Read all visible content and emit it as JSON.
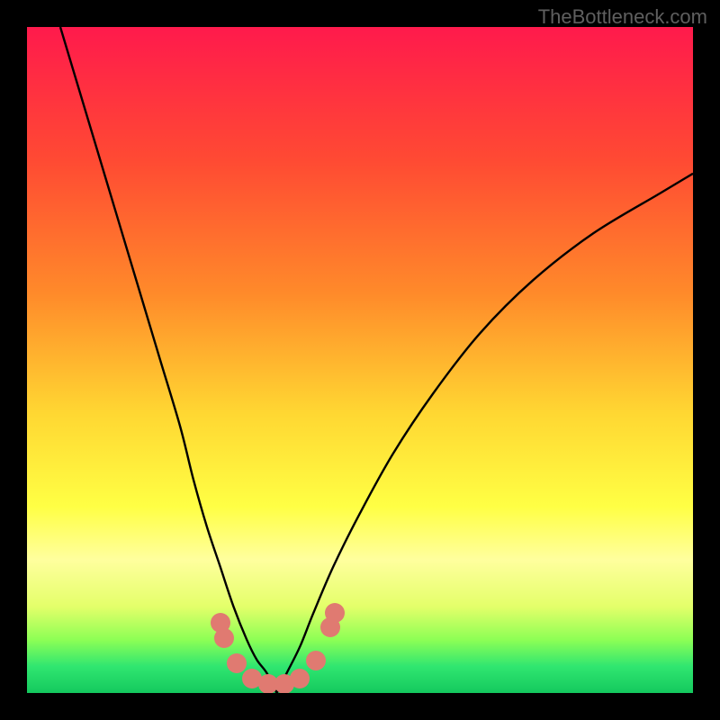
{
  "watermark": "TheBottleneck.com",
  "chart_data": {
    "type": "line",
    "title": "",
    "xlabel": "",
    "ylabel": "",
    "xlim": [
      0,
      100
    ],
    "ylim": [
      0,
      100
    ],
    "gradient_stops": [
      {
        "offset": 0,
        "color": "#ff1a4c"
      },
      {
        "offset": 20,
        "color": "#ff4a33"
      },
      {
        "offset": 40,
        "color": "#ff8a2a"
      },
      {
        "offset": 58,
        "color": "#ffd732"
      },
      {
        "offset": 72,
        "color": "#ffff44"
      },
      {
        "offset": 80,
        "color": "#ffff9e"
      },
      {
        "offset": 87,
        "color": "#e4ff6a"
      },
      {
        "offset": 92,
        "color": "#8dff55"
      },
      {
        "offset": 96,
        "color": "#30e670"
      },
      {
        "offset": 100,
        "color": "#14c95e"
      }
    ],
    "series": [
      {
        "name": "left-branch",
        "x": [
          5,
          8,
          11,
          14,
          17,
          20,
          23,
          25,
          27,
          29,
          31,
          33,
          34.5,
          36,
          37.5
        ],
        "y": [
          100,
          90,
          80,
          70,
          60,
          50,
          40,
          32,
          25,
          19,
          13,
          8,
          5,
          3,
          0
        ]
      },
      {
        "name": "right-branch",
        "x": [
          37.5,
          39,
          41,
          43,
          46,
          50,
          55,
          61,
          68,
          76,
          85,
          95,
          100
        ],
        "y": [
          0,
          3,
          7,
          12,
          19,
          27,
          36,
          45,
          54,
          62,
          69,
          75,
          78
        ]
      }
    ],
    "markers": {
      "name": "salmon-dots",
      "color": "#e07a71",
      "points": [
        {
          "x": 29.0,
          "y": 10.5,
          "r": 11
        },
        {
          "x": 29.6,
          "y": 8.3,
          "r": 11
        },
        {
          "x": 31.5,
          "y": 4.5,
          "r": 11
        },
        {
          "x": 33.8,
          "y": 2.2,
          "r": 11
        },
        {
          "x": 36.2,
          "y": 1.4,
          "r": 11
        },
        {
          "x": 38.6,
          "y": 1.4,
          "r": 11
        },
        {
          "x": 41.0,
          "y": 2.2,
          "r": 11
        },
        {
          "x": 43.4,
          "y": 4.8,
          "r": 11
        },
        {
          "x": 45.5,
          "y": 9.8,
          "r": 11
        },
        {
          "x": 46.2,
          "y": 12.0,
          "r": 11
        }
      ]
    }
  }
}
